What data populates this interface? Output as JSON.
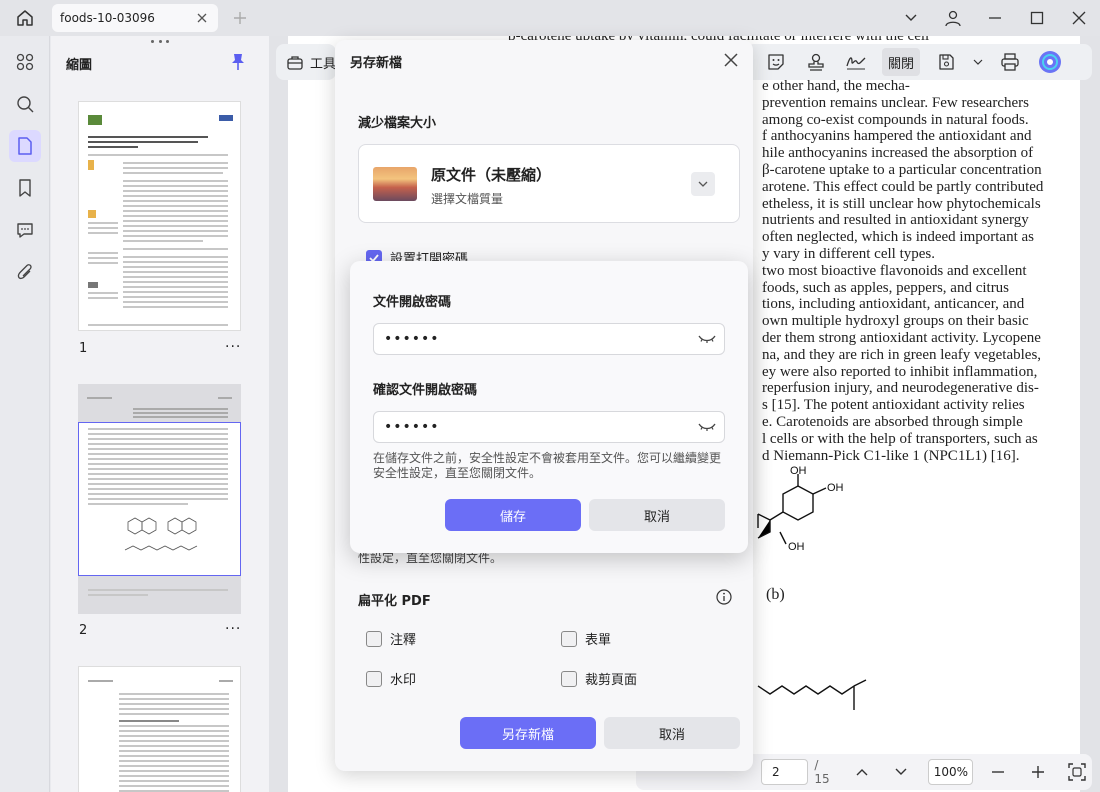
{
  "titlebar": {
    "tab_title": "foods-10-03096"
  },
  "thumbs": {
    "title": "縮圖",
    "pages": [
      {
        "number": "1",
        "more": "···"
      },
      {
        "number": "2",
        "more": "···"
      }
    ]
  },
  "toolbar": {
    "tools_label": "工具",
    "close_label": "關閉"
  },
  "pagenav": {
    "current_page": "2",
    "total_pages": "/ 15",
    "zoom": "100%"
  },
  "doc": {
    "top_line": "β-carotene uptake by vitamin, could facilitate or interfere with the cell",
    "lines": [
      "e other hand, the mecha-",
      "prevention remains unclear. Few researchers",
      "among co-exist compounds in natural foods.",
      "f anthocyanins hampered the antioxidant and",
      "hile anthocyanins increased the absorption of",
      "β-carotene uptake to a particular concentration",
      "arotene. This effect could be partly contributed",
      "etheless, it is still unclear how phytochemicals",
      "nutrients and resulted in antioxidant synergy",
      "often neglected, which is indeed important as",
      "y vary in different cell types.",
      "two most bioactive flavonoids and excellent",
      " foods, such as apples, peppers, and citrus",
      "tions, including antioxidant, anticancer, and",
      "own multiple hydroxyl groups on their basic",
      "der them strong antioxidant activity. Lycopene",
      "na, and they are rich in green leafy vegetables,",
      "ey were also reported to inhibit inflammation,",
      "reperfusion injury, and neurodegenerative dis-",
      "s [15].  The potent antioxidant activity relies",
      "e. Carotenoids are absorbed through simple",
      "l cells or with the help of transporters, such as",
      "d Niemann-Pick C1-like 1 (NPC1L1) [16]."
    ],
    "fig_label": "(b)"
  },
  "dialog": {
    "title": "另存新檔",
    "reduce_size_label": "減少檔案大小",
    "quality_title": "原文件（未壓縮）",
    "quality_sub": "選擇文檔質量",
    "open_password_label": "設置打開密碼",
    "hidden_note": "性設定，直至您關閉文件。",
    "flatten_label": "扁平化 PDF",
    "flatten_options": [
      "注釋",
      "表單",
      "水印",
      "裁剪頁面"
    ],
    "save_as_button": "另存新檔",
    "cancel_button": "取消"
  },
  "password_popup": {
    "open_password_label": "文件開啟密碼",
    "open_password_value": "••••••",
    "confirm_password_label": "確認文件開啟密碼",
    "confirm_password_value": "••••••",
    "note": "在儲存文件之前，安全性設定不會被套用至文件。您可以繼續變更安全性設定，直至您關閉文件。",
    "save_button": "儲存",
    "cancel_button": "取消"
  }
}
